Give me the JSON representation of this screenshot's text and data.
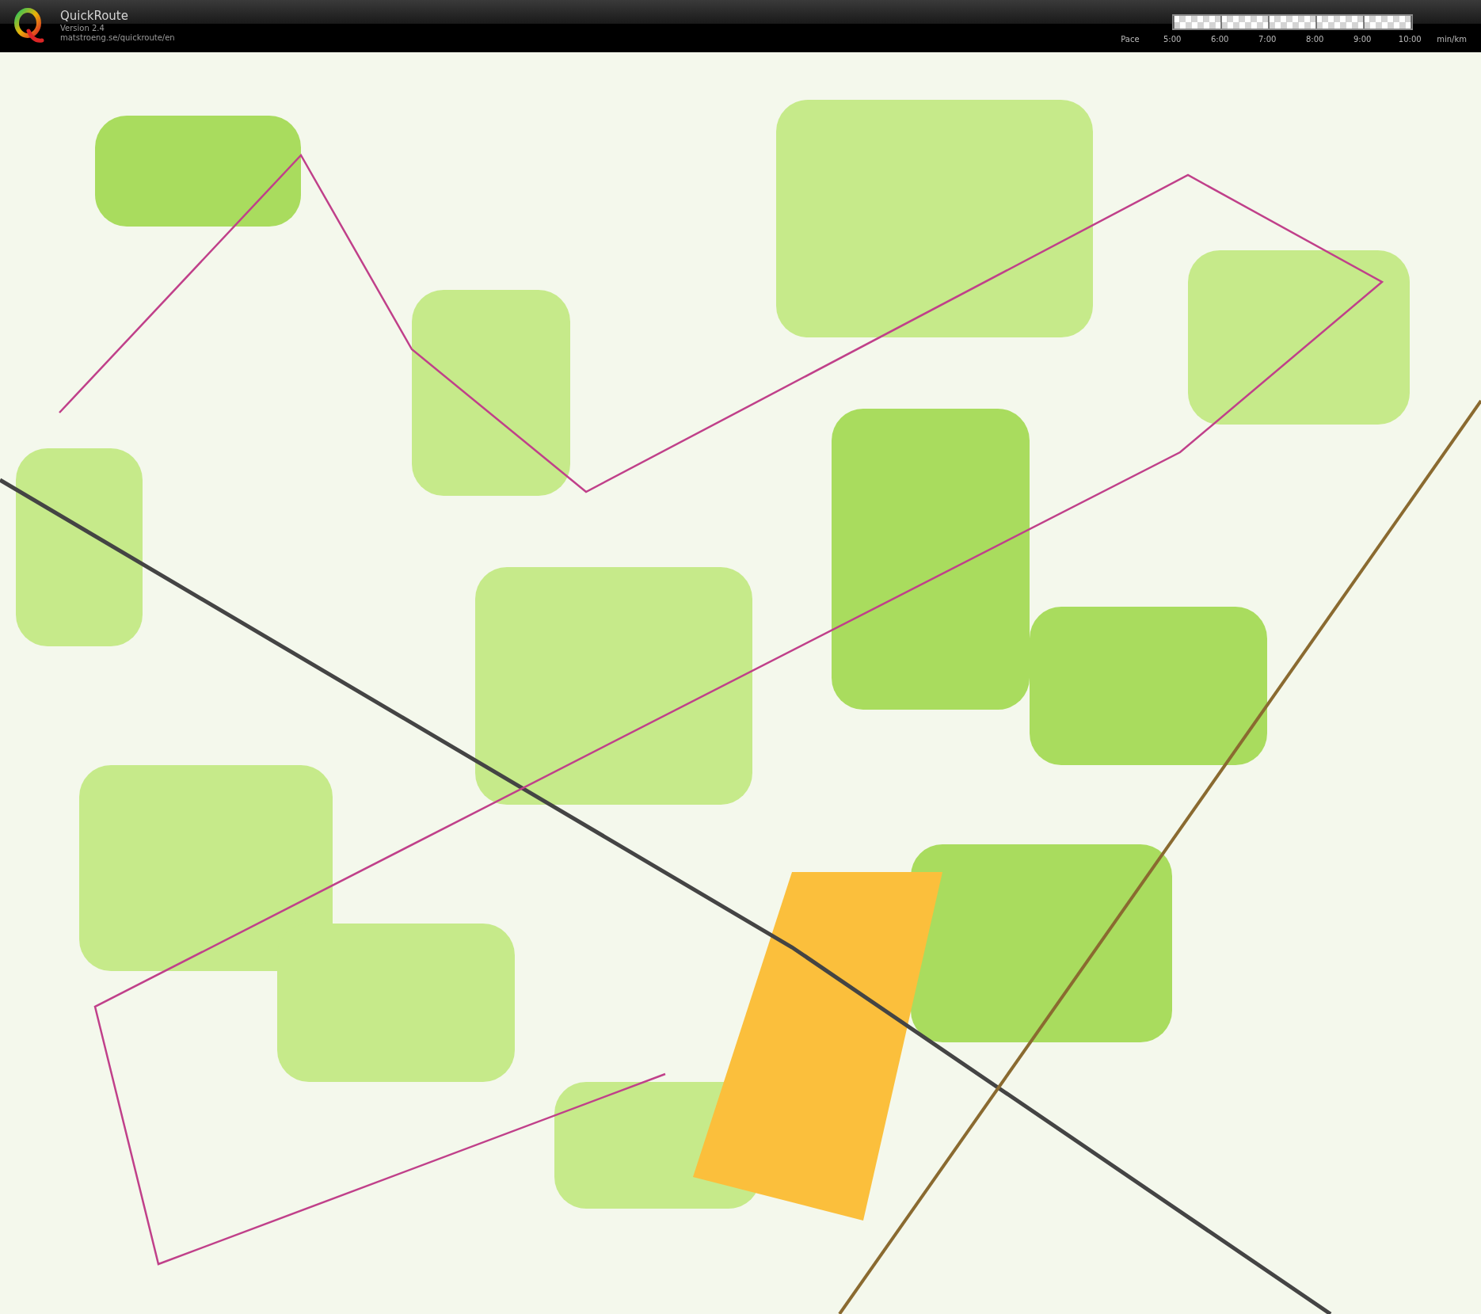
{
  "app": {
    "title": "QuickRoute",
    "version": "Version 2.4",
    "url": "matstroeng.se/quickroute/en"
  },
  "pace_scale": {
    "label": "Pace",
    "ticks": [
      "5:00",
      "6:00",
      "7:00",
      "8:00",
      "9:00",
      "10:00"
    ],
    "unit": "min/km"
  }
}
